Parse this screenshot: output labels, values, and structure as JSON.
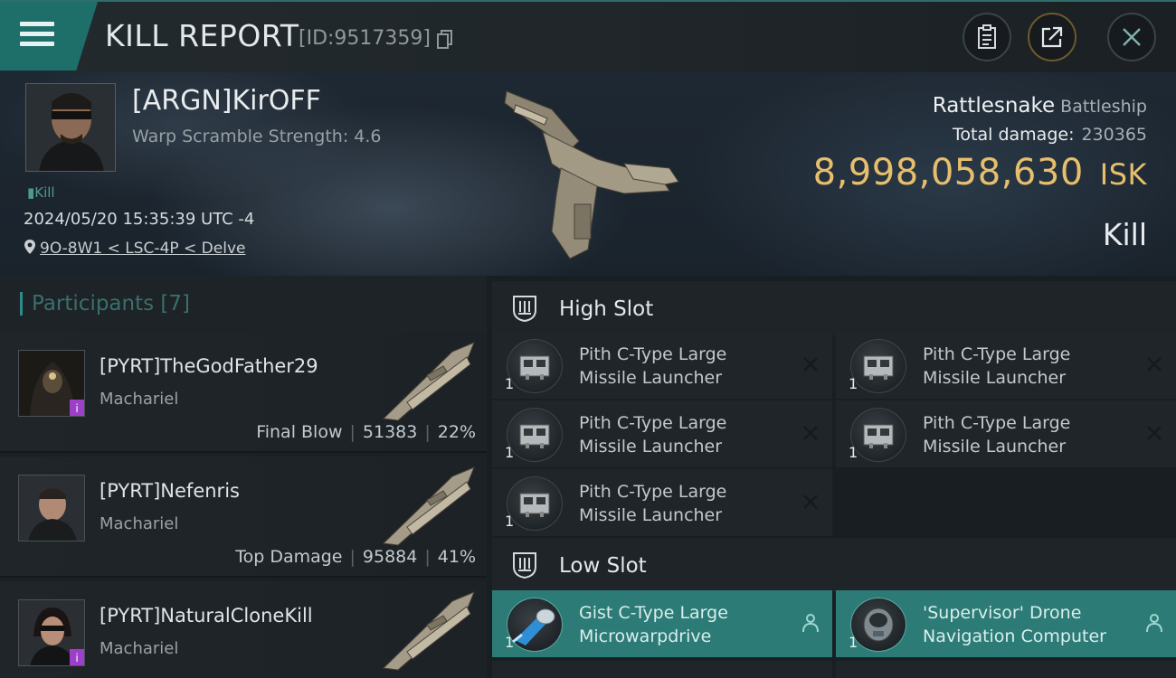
{
  "header": {
    "title": "KILL REPORT",
    "report_id": "[ID:9517359]",
    "menu_icon": "hamburger-menu-icon",
    "copy_icon": "copy-icon",
    "buttons": [
      {
        "name": "clipboard-button",
        "icon": "clipboard-icon"
      },
      {
        "name": "share-button",
        "icon": "share-icon"
      },
      {
        "name": "close-button",
        "icon": "close-icon"
      }
    ]
  },
  "victim": {
    "name": "[ARGN]⁣KirOFF⁣",
    "warp_scramble": "Warp Scramble Strength: 4.6",
    "kill_tag": "Kill",
    "datetime": "2024/05/20 15:35:39 UTC -4",
    "location": "9O-8W1 < LSC-4P < Delve",
    "ship_name": "Rattlesnake",
    "ship_class": "Battleship",
    "total_damage_label": "Total damage:",
    "total_damage": "230365",
    "isk_value": "8,998,058,630",
    "isk_unit": "ISK",
    "result": "Kill"
  },
  "participants": {
    "title": "Participants",
    "count": "[7]",
    "rows": [
      {
        "name": "[PYRT]TheGodFather29",
        "ship": "Machariel",
        "role": "Final Blow",
        "damage": "51383",
        "percent": "22%"
      },
      {
        "name": "[PYRT]Nefenris",
        "ship": "Machariel",
        "role": "Top Damage",
        "damage": "95884",
        "percent": "41%"
      },
      {
        "name": "[PYRT]NaturalCloneKill",
        "ship": "Machariel",
        "role": "",
        "damage": "",
        "percent": ""
      }
    ]
  },
  "slots": {
    "high": {
      "title": "High Slot",
      "modules": [
        {
          "qty": "1",
          "name_line1": "Pith C-Type Large",
          "name_line2": "Missile Launcher",
          "status": "destroyed"
        },
        {
          "qty": "1",
          "name_line1": "Pith C-Type Large",
          "name_line2": "Missile Launcher",
          "status": "destroyed"
        },
        {
          "qty": "1",
          "name_line1": "Pith C-Type Large",
          "name_line2": "Missile Launcher",
          "status": "destroyed"
        },
        {
          "qty": "1",
          "name_line1": "Pith C-Type Large",
          "name_line2": "Missile Launcher",
          "status": "destroyed"
        },
        {
          "qty": "1",
          "name_line1": "Pith C-Type Large",
          "name_line2": "Missile Launcher",
          "status": "destroyed"
        }
      ]
    },
    "low": {
      "title": "Low Slot",
      "modules": [
        {
          "qty": "1",
          "name_line1": "Gist C-Type Large",
          "name_line2": "Microwarpdrive",
          "status": "dropped"
        },
        {
          "qty": "1",
          "name_line1": "'Supervisor' Drone",
          "name_line2": "Navigation Computer",
          "status": "dropped"
        }
      ]
    }
  },
  "colors": {
    "accent": "#2e8b86",
    "isk_gold": "#e7bf6c",
    "active_module": "#2c7b76"
  }
}
